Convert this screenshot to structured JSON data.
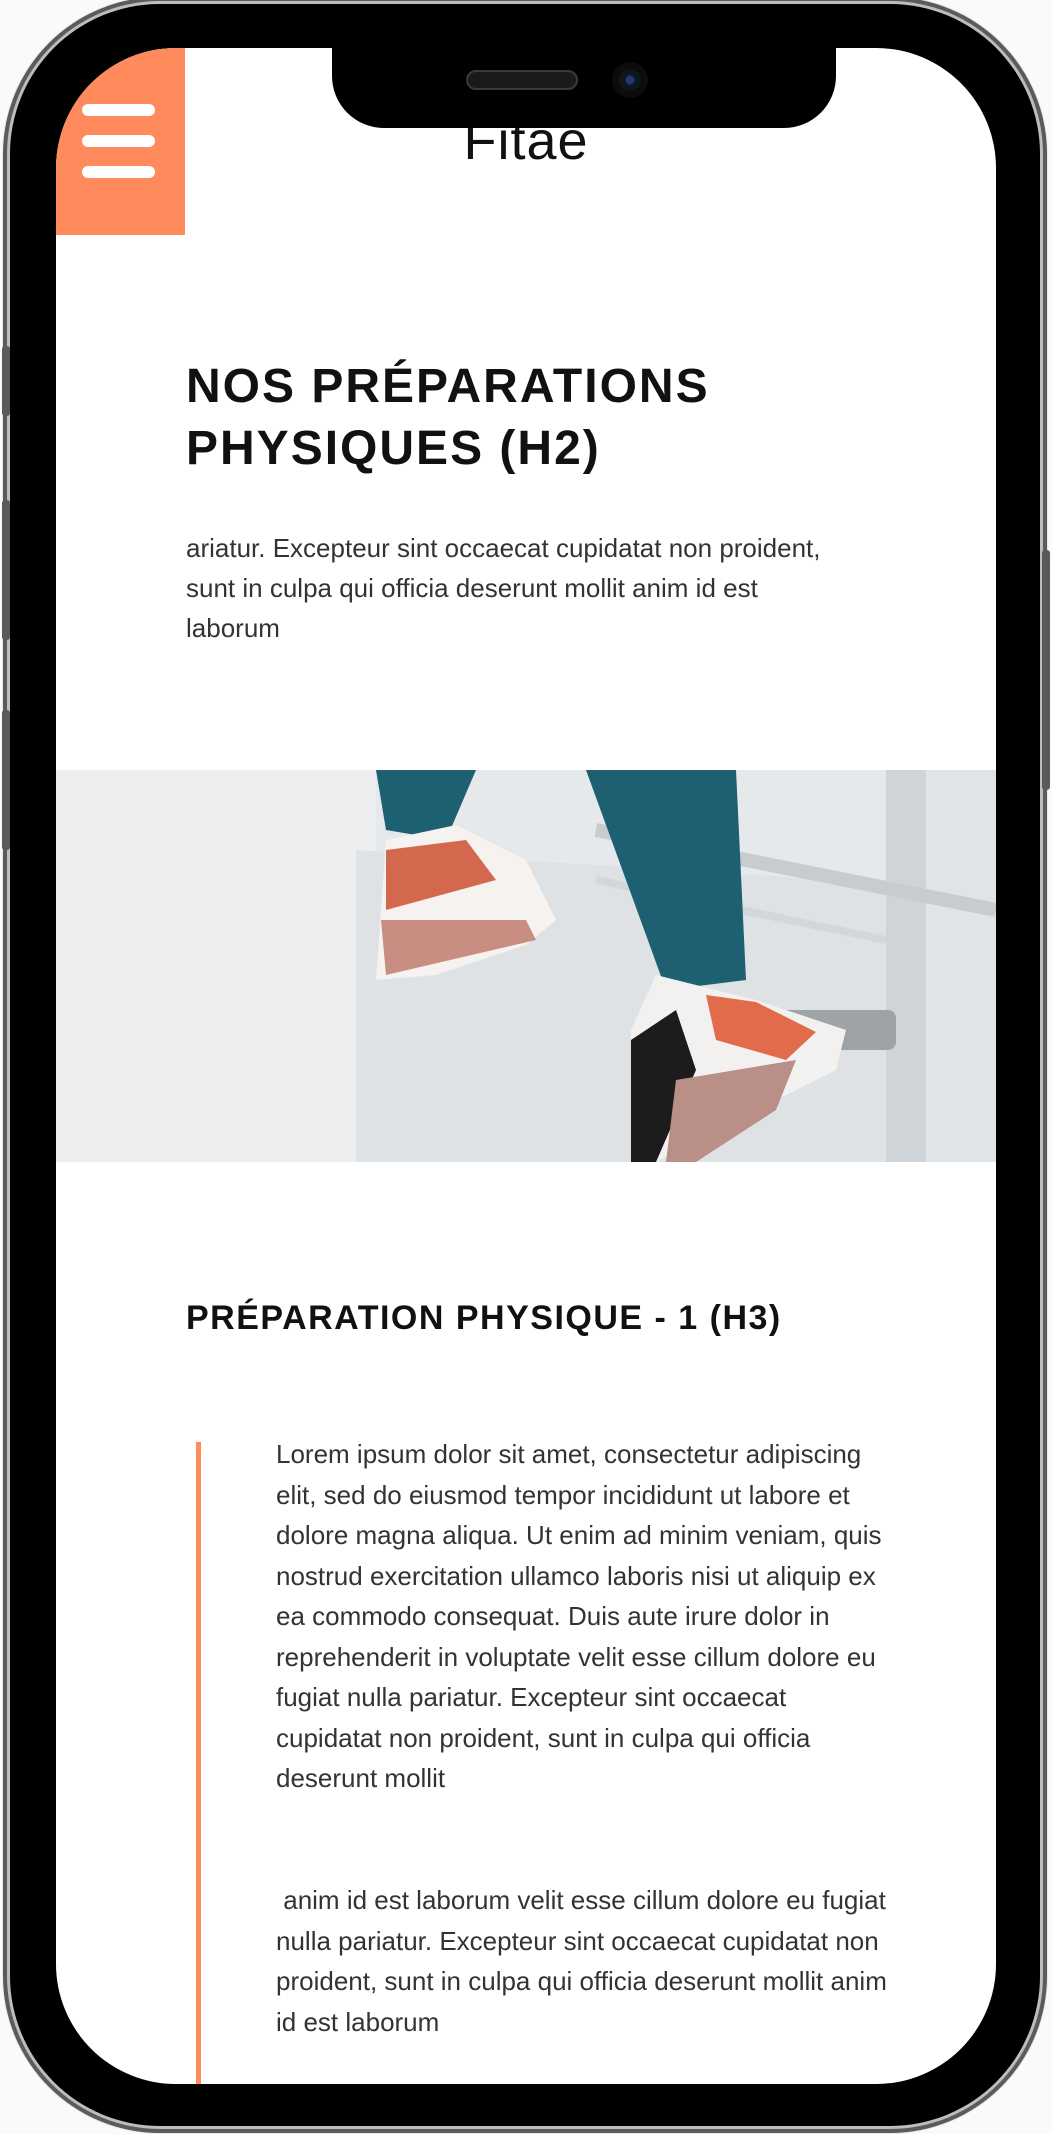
{
  "header": {
    "menu_icon": "hamburger-menu-icon",
    "brand": "Fitae"
  },
  "section": {
    "title": "NOS PRÉPARATIONS PHYSIQUES (H2)",
    "intro": "ariatur. Excepteur sint occaecat cupidatat non proident, sunt in culpa qui officia deserunt mollit anim id est laborum"
  },
  "hero_image": {
    "description": "running shoes on stairs"
  },
  "subsection": {
    "title": "PRÉPARATION PHYSIQUE - 1 (H3)",
    "paragraph1": "Lorem ipsum dolor sit amet, consectetur adipiscing elit, sed do eiusmod tempor incididunt ut labore et dolore magna aliqua. Ut enim ad minim veniam, quis nostrud exercitation ullamco laboris nisi ut aliquip ex ea commodo consequat. Duis aute irure dolor in reprehenderit in voluptate velit esse cillum dolore eu fugiat nulla pariatur. Excepteur sint occaecat cupidatat non proident, sunt in culpa qui officia deserunt mollit",
    "paragraph2": " anim id est laborum velit esse cillum dolore eu fugiat nulla pariatur. Excepteur sint occaecat cupidatat non proident, sunt in culpa qui officia deserunt mollit anim id est laborum"
  },
  "colors": {
    "accent": "#ff8a5c",
    "text": "#333333",
    "heading": "#111111"
  }
}
